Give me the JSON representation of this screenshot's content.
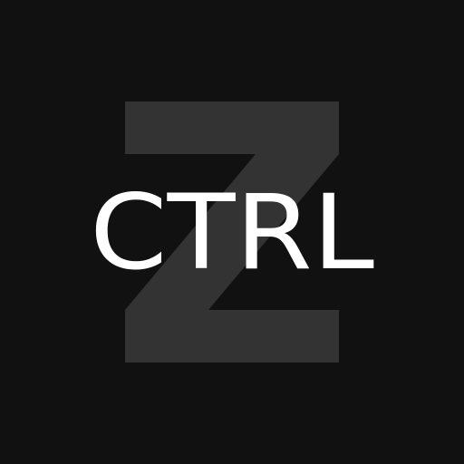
{
  "logo": {
    "background_color": "#111111",
    "large_letter": "Z",
    "large_letter_color": "#333333",
    "word": "CTRL",
    "word_color": "#ffffff"
  }
}
